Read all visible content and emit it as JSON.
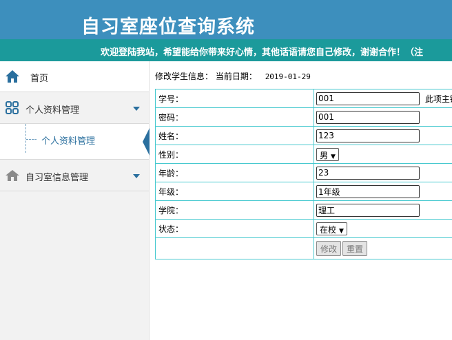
{
  "header": {
    "title": "自习室座位查询系统"
  },
  "marquee": {
    "text": "欢迎登陆我站，希望能给你带来好心情，其他话语请您自己修改，谢谢合作！（注"
  },
  "sidebar": {
    "home_label": "首页",
    "groups": [
      {
        "label": "个人资料管理",
        "icon": "grid-icon"
      },
      {
        "label": "自习室信息管理",
        "icon": "house-icon"
      }
    ],
    "submenu_items": [
      {
        "label": "个人资料管理"
      }
    ]
  },
  "content": {
    "info_label": "修改学生信息：",
    "date_label": "当前日期：",
    "date_value": "2019-01-29",
    "form": {
      "student_id": {
        "label": "学号：",
        "value": "001",
        "hint": "此项主键"
      },
      "password": {
        "label": "密码：",
        "value": "001"
      },
      "name": {
        "label": "姓名：",
        "value": "123"
      },
      "gender": {
        "label": "性别：",
        "value": "男"
      },
      "age": {
        "label": "年龄：",
        "value": "23"
      },
      "grade": {
        "label": "年级：",
        "value": "1年级"
      },
      "college": {
        "label": "学院：",
        "value": "理工"
      },
      "status": {
        "label": "状态：",
        "value": "在校"
      },
      "submit_label": "修改",
      "reset_label": "重置"
    }
  },
  "colors": {
    "header_bg": "#3d8fbd",
    "marquee_bg": "#1b9a9b",
    "accent": "#2a6f9e",
    "table_border": "#46c9cf"
  }
}
